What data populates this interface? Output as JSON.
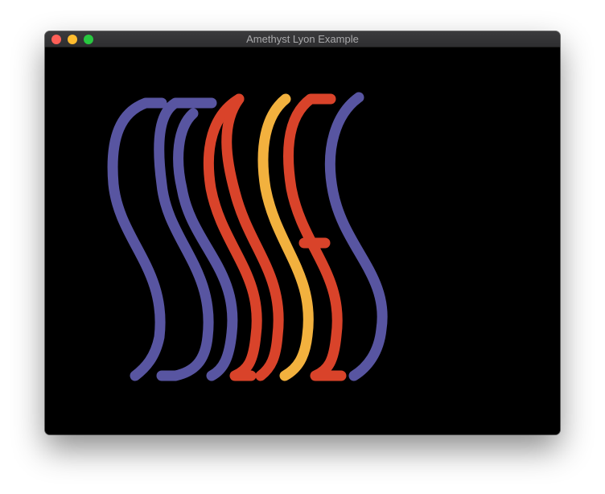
{
  "window": {
    "title": "Amethyst Lyon Example",
    "controls": {
      "close_color": "#fe5f57",
      "minimize_color": "#febc2e",
      "zoom_color": "#28c840"
    }
  },
  "canvas": {
    "background": "#000000",
    "colors": {
      "purple": "#5855a1",
      "red": "#d9432a",
      "orange": "#f2b13e"
    }
  }
}
